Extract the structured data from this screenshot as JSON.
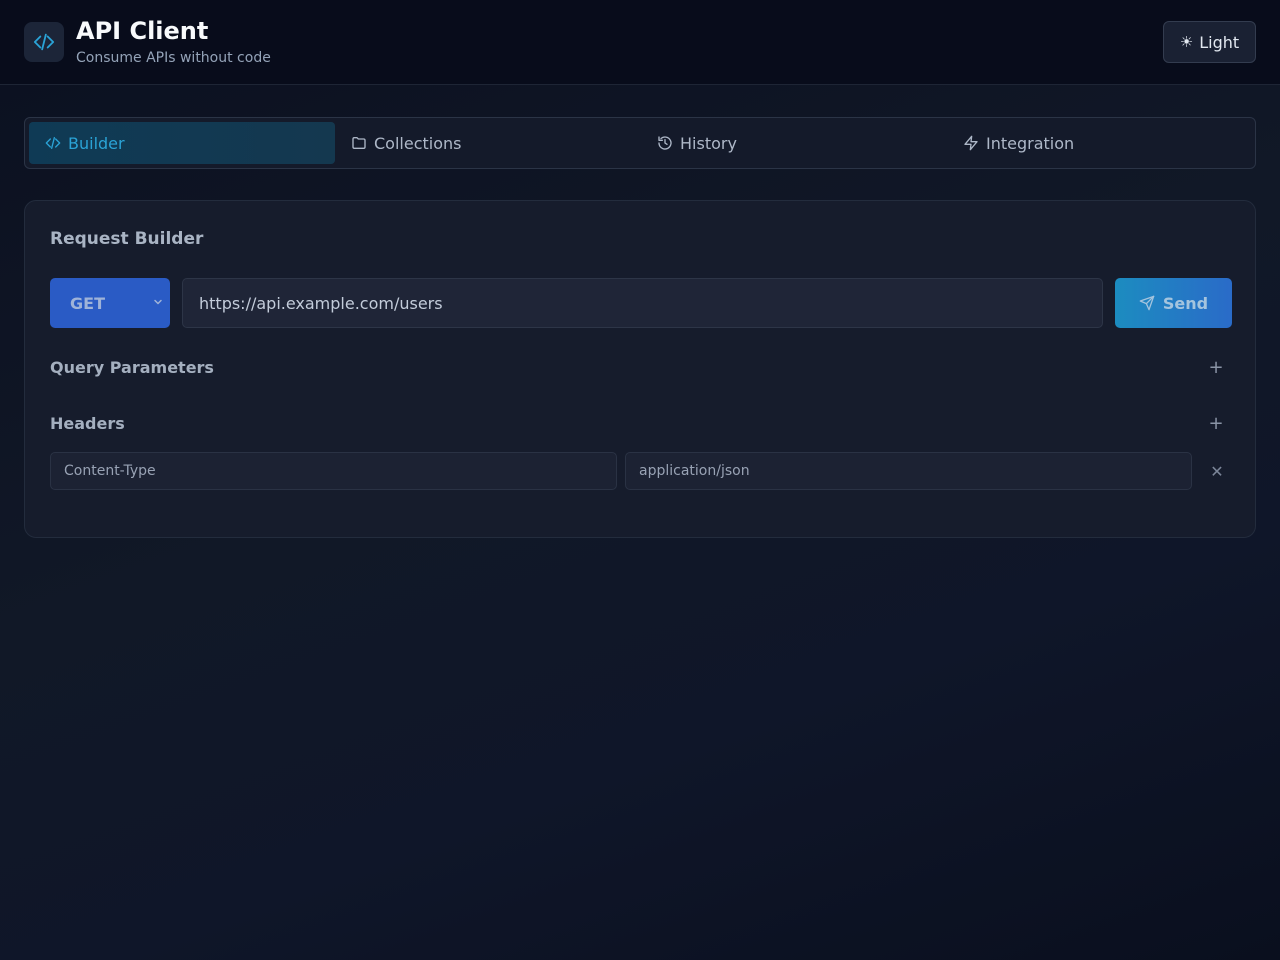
{
  "header": {
    "title": "API Client",
    "subtitle": "Consume APIs without code",
    "theme_toggle_label": "Light"
  },
  "tabs": [
    {
      "label": "Builder",
      "icon": "code-icon",
      "active": true
    },
    {
      "label": "Collections",
      "icon": "folder-icon",
      "active": false
    },
    {
      "label": "History",
      "icon": "history-icon",
      "active": false
    },
    {
      "label": "Integration",
      "icon": "zap-icon",
      "active": false
    }
  ],
  "builder": {
    "title": "Request Builder",
    "method": "GET",
    "url": "https://api.example.com/users",
    "send_label": "Send",
    "query_params_label": "Query Parameters",
    "headers_label": "Headers",
    "headers": [
      {
        "key": "Content-Type",
        "value": "application/json"
      }
    ]
  },
  "colors": {
    "accent": "#2aa3d6",
    "method_bg": "#2a5bc5",
    "background": "#0b1020"
  }
}
